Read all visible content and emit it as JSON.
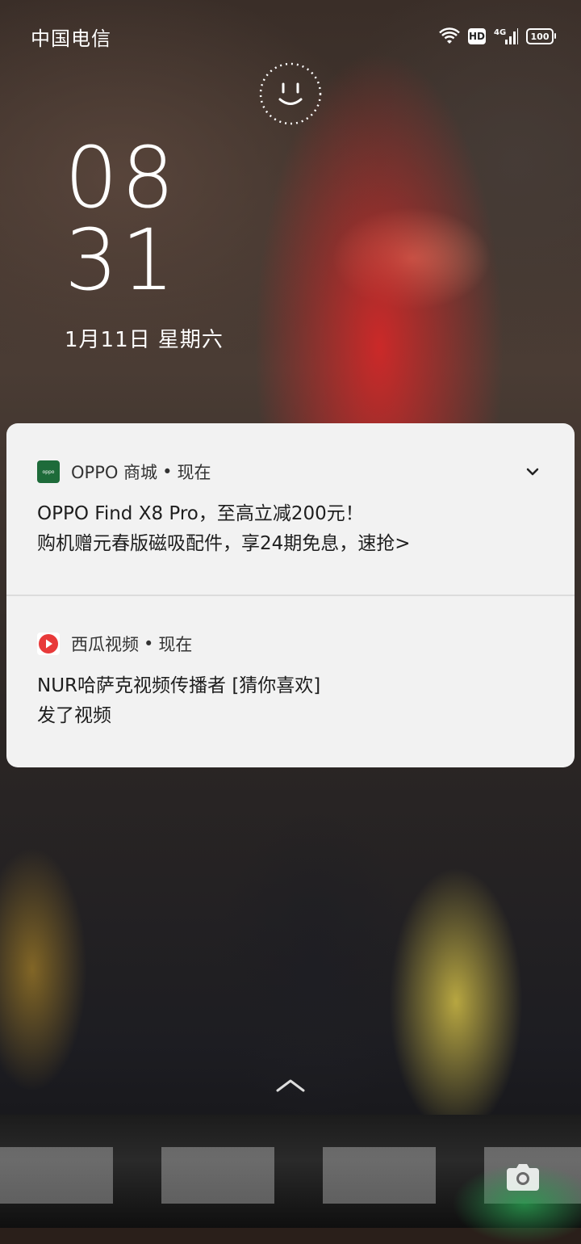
{
  "status_bar": {
    "carrier": "中国电信",
    "network": "4G",
    "hd": "HD",
    "battery": "100"
  },
  "lock_screen": {
    "clock_hour": "08",
    "clock_minute": "31",
    "date": "1月11日  星期六"
  },
  "notifications": [
    {
      "app": "OPPO 商城",
      "time": "现在",
      "line1": "OPPO Find X8 Pro，至高立减200元！",
      "line2": "购机赠元春版磁吸配件，享24期免息，速抢>",
      "icon": "oppo-store-icon",
      "icon_label": "oppo",
      "accent": "#1e6b3a"
    },
    {
      "app": "西瓜视频",
      "time": "现在",
      "line1": "NUR哈萨克视频传播者 [猜你喜欢]",
      "line2": "发了视频",
      "icon": "xigua-video-icon",
      "accent": "#e83a3a"
    }
  ],
  "icons": {
    "face_unlock": "face-unlock-icon",
    "swipe_up": "chevron-up-icon",
    "camera": "camera-icon",
    "expand": "chevron-down-icon"
  }
}
